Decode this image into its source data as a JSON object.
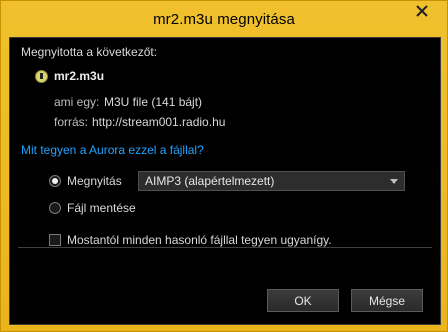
{
  "window": {
    "title": "mr2.m3u megnyitása"
  },
  "dialog": {
    "intro": "Megnyitotta a következőt:",
    "filename": "mr2.m3u",
    "type_label": "ami egy:",
    "type_value": "M3U file (141 bájt)",
    "source_label": "forrás:",
    "source_value": "http://stream001.radio.hu",
    "question": "Mit tegyen a Aurora ezzel a fájllal?",
    "open_with_label": "Megnyitás",
    "open_with_app": "AIMP3 (alapértelmezett)",
    "save_file_label": "Fájl mentése",
    "remember_label": "Mostantól minden hasonló fájllal tegyen ugyanígy.",
    "ok_label": "OK",
    "cancel_label": "Mégse"
  },
  "state": {
    "action": "open",
    "remember_checked": false
  }
}
